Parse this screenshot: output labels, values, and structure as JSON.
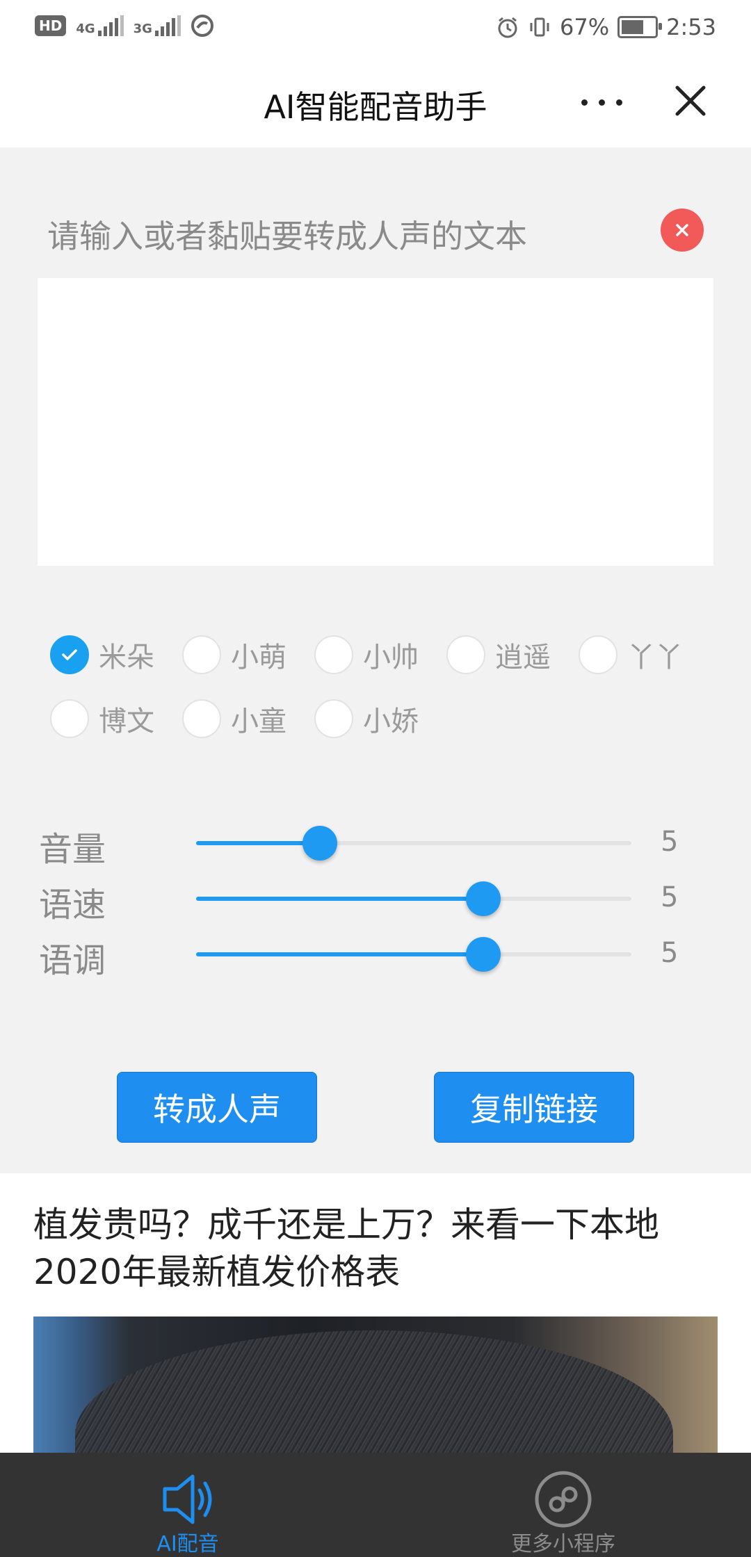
{
  "status_bar": {
    "left_icons": [
      "hd-icon",
      "signal-4g-icon",
      "signal-3g-icon",
      "sync-icon"
    ],
    "hd_label": "HD",
    "net1_label": "4G",
    "net2_label": "3G",
    "battery_percent": "67%",
    "battery_level": 0.67,
    "time": "2:53"
  },
  "nav": {
    "title": "AI智能配音助手"
  },
  "editor": {
    "placeholder_label": "请输入或者黏贴要转成人声的文本",
    "input_value": "",
    "clear_color": "#f25a5a"
  },
  "voices": {
    "selected": "米朵",
    "items": [
      {
        "label": "米朵",
        "checked": true
      },
      {
        "label": "小萌",
        "checked": false
      },
      {
        "label": "小帅",
        "checked": false
      },
      {
        "label": "逍遥",
        "checked": false
      },
      {
        "label": "丫丫",
        "checked": false
      },
      {
        "label": "博文",
        "checked": false
      },
      {
        "label": "小童",
        "checked": false
      },
      {
        "label": "小娇",
        "checked": false
      }
    ]
  },
  "sliders": [
    {
      "label": "音量",
      "value": "5",
      "level": 0.285
    },
    {
      "label": "语速",
      "value": "5",
      "level": 0.66
    },
    {
      "label": "语调",
      "value": "5",
      "level": 0.66
    }
  ],
  "actions": {
    "convert_label": "转成人声",
    "copy_label": "复制链接"
  },
  "ad": {
    "title": "植发贵吗？成千还是上万？来看一下本地2020年最新植发价格表"
  },
  "tabs": {
    "ai_label": "AI配音",
    "more_label": "更多小程序",
    "active_color": "#1e8ef0",
    "inactive_color": "#8c8c8c"
  }
}
